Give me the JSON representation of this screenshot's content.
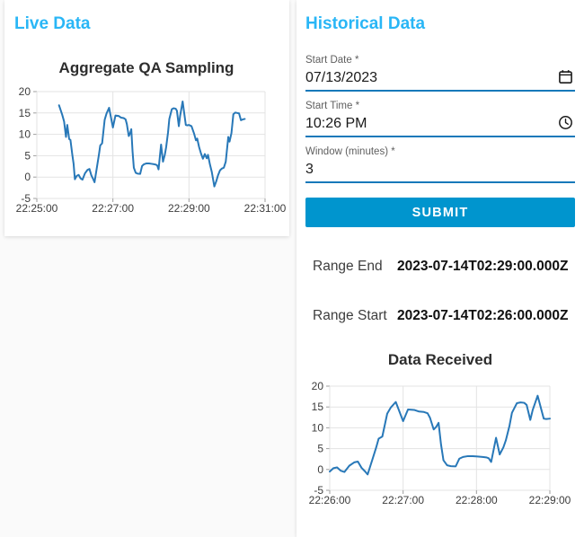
{
  "colors": {
    "accent_heading": "#29b6f6",
    "submit_button_bg": "#0095ce",
    "field_underline": "#1779ba",
    "chart_line": "#2878b8",
    "page_bg": "#fafafa"
  },
  "live": {
    "title": "Live Data"
  },
  "historical": {
    "title": "Historical Data",
    "fields": [
      {
        "label": "Start Date *",
        "value": "07/13/2023",
        "icon": "calendar"
      },
      {
        "label": "Start Time *",
        "value": "10:26 PM",
        "icon": "clock"
      },
      {
        "label": "Window (minutes) *",
        "value": "3",
        "icon": ""
      }
    ],
    "submit_label": "SUBMIT",
    "results": [
      {
        "label": "Range End",
        "value": "2023-07-14T02:29:00.000Z"
      },
      {
        "label": "Range Start",
        "value": "2023-07-14T02:26:00.000Z"
      }
    ]
  },
  "chart_data": [
    {
      "type": "line",
      "title": "Aggregate QA Sampling",
      "xlabel": "",
      "ylabel": "",
      "x_unit": "seconds since 22:25:00",
      "x_range": [
        0,
        360
      ],
      "y_range": [
        -5,
        20
      ],
      "grid": true,
      "legend": "none",
      "line_color": "#2878b8",
      "x_ticks": [
        {
          "t": 0,
          "label": "22:25:00"
        },
        {
          "t": 120,
          "label": "22:27:00"
        },
        {
          "t": 240,
          "label": "22:29:00"
        },
        {
          "t": 360,
          "label": "22:31:00"
        }
      ],
      "y_ticks": [
        -5,
        0,
        5,
        10,
        15,
        20
      ],
      "points": [
        [
          35,
          16.8
        ],
        [
          40,
          14.6
        ],
        [
          43,
          13.0
        ],
        [
          46,
          9.4
        ],
        [
          48,
          12.2
        ],
        [
          51,
          8.9
        ],
        [
          53,
          8.7
        ],
        [
          56,
          5.2
        ],
        [
          58,
          3.1
        ],
        [
          60,
          -0.5
        ],
        [
          63,
          0.3
        ],
        [
          66,
          0.5
        ],
        [
          69,
          -0.3
        ],
        [
          72,
          -0.6
        ],
        [
          76,
          0.9
        ],
        [
          80,
          1.7
        ],
        [
          83,
          1.9
        ],
        [
          86,
          0.4
        ],
        [
          89,
          -0.5
        ],
        [
          91,
          -1.2
        ],
        [
          95,
          2.5
        ],
        [
          98,
          5.3
        ],
        [
          100,
          7.4
        ],
        [
          103,
          7.9
        ],
        [
          107,
          13.4
        ],
        [
          110,
          14.9
        ],
        [
          114,
          16.2
        ],
        [
          120,
          11.6
        ],
        [
          124,
          14.4
        ],
        [
          129,
          14.3
        ],
        [
          133,
          13.9
        ],
        [
          137,
          13.8
        ],
        [
          140,
          13.5
        ],
        [
          142,
          12.4
        ],
        [
          145,
          9.6
        ],
        [
          147,
          10.2
        ],
        [
          149,
          11.2
        ],
        [
          151,
          6.0
        ],
        [
          153,
          2.2
        ],
        [
          156,
          1.0
        ],
        [
          159,
          0.8
        ],
        [
          163,
          0.75
        ],
        [
          166,
          2.6
        ],
        [
          169,
          3.0
        ],
        [
          173,
          3.2
        ],
        [
          177,
          3.2
        ],
        [
          181,
          3.1
        ],
        [
          185,
          3.0
        ],
        [
          188,
          2.9
        ],
        [
          190,
          2.7
        ],
        [
          192,
          1.8
        ],
        [
          196,
          7.6
        ],
        [
          199,
          3.6
        ],
        [
          202,
          5.3
        ],
        [
          204,
          7.0
        ],
        [
          207,
          10.5
        ],
        [
          209,
          13.6
        ],
        [
          213,
          15.9
        ],
        [
          216,
          16.1
        ],
        [
          219,
          16.0
        ],
        [
          221,
          15.5
        ],
        [
          224,
          11.9
        ],
        [
          226,
          14.3
        ],
        [
          230,
          17.7
        ],
        [
          235,
          12.2
        ],
        [
          237,
          12.1
        ],
        [
          240,
          12.2
        ],
        [
          244,
          11.9
        ],
        [
          248,
          10.2
        ],
        [
          251,
          8.6
        ],
        [
          253,
          9.0
        ],
        [
          256,
          7.0
        ],
        [
          259,
          5.5
        ],
        [
          262,
          4.3
        ],
        [
          265,
          5.4
        ],
        [
          268,
          4.4
        ],
        [
          270,
          5.2
        ],
        [
          273,
          3.0
        ],
        [
          276,
          1.2
        ],
        [
          280,
          -2.2
        ],
        [
          283,
          -1.0
        ],
        [
          286,
          0.5
        ],
        [
          289,
          1.6
        ],
        [
          292,
          2.0
        ],
        [
          295,
          2.2
        ],
        [
          298,
          3.6
        ],
        [
          302,
          9.4
        ],
        [
          304,
          8.3
        ],
        [
          307,
          10.3
        ],
        [
          310,
          14.7
        ],
        [
          313,
          15.1
        ],
        [
          316,
          15.0
        ],
        [
          319,
          14.9
        ],
        [
          322,
          13.3
        ],
        [
          325,
          13.5
        ],
        [
          328,
          13.6
        ]
      ]
    },
    {
      "type": "line",
      "title": "Data Received",
      "xlabel": "",
      "ylabel": "",
      "x_unit": "seconds since 22:25:00",
      "x_range": [
        60,
        240
      ],
      "y_range": [
        -5,
        20
      ],
      "grid": true,
      "legend": "none",
      "line_color": "#2878b8",
      "x_ticks": [
        {
          "t": 60,
          "label": "22:26:00"
        },
        {
          "t": 120,
          "label": "22:27:00"
        },
        {
          "t": 180,
          "label": "22:28:00"
        },
        {
          "t": 240,
          "label": "22:29:00"
        }
      ],
      "y_ticks": [
        -5,
        0,
        5,
        10,
        15,
        20
      ],
      "points": [
        [
          60,
          -0.5
        ],
        [
          63,
          0.3
        ],
        [
          66,
          0.5
        ],
        [
          69,
          -0.3
        ],
        [
          72,
          -0.6
        ],
        [
          76,
          0.9
        ],
        [
          80,
          1.7
        ],
        [
          83,
          1.9
        ],
        [
          86,
          0.4
        ],
        [
          89,
          -0.5
        ],
        [
          91,
          -1.2
        ],
        [
          95,
          2.5
        ],
        [
          98,
          5.3
        ],
        [
          100,
          7.4
        ],
        [
          103,
          7.9
        ],
        [
          107,
          13.4
        ],
        [
          110,
          14.9
        ],
        [
          114,
          16.2
        ],
        [
          120,
          11.6
        ],
        [
          124,
          14.4
        ],
        [
          129,
          14.3
        ],
        [
          133,
          13.9
        ],
        [
          137,
          13.8
        ],
        [
          140,
          13.5
        ],
        [
          142,
          12.4
        ],
        [
          145,
          9.6
        ],
        [
          147,
          10.2
        ],
        [
          149,
          11.2
        ],
        [
          151,
          6.0
        ],
        [
          153,
          2.2
        ],
        [
          156,
          1.0
        ],
        [
          159,
          0.8
        ],
        [
          163,
          0.75
        ],
        [
          166,
          2.6
        ],
        [
          169,
          3.0
        ],
        [
          173,
          3.2
        ],
        [
          177,
          3.2
        ],
        [
          181,
          3.1
        ],
        [
          185,
          3.0
        ],
        [
          188,
          2.9
        ],
        [
          190,
          2.7
        ],
        [
          192,
          1.8
        ],
        [
          196,
          7.6
        ],
        [
          199,
          3.6
        ],
        [
          202,
          5.3
        ],
        [
          204,
          7.0
        ],
        [
          207,
          10.5
        ],
        [
          209,
          13.6
        ],
        [
          213,
          15.9
        ],
        [
          216,
          16.1
        ],
        [
          219,
          16.0
        ],
        [
          221,
          15.5
        ],
        [
          224,
          11.9
        ],
        [
          226,
          14.3
        ],
        [
          230,
          17.7
        ],
        [
          235,
          12.2
        ],
        [
          237,
          12.1
        ],
        [
          240,
          12.2
        ]
      ]
    }
  ]
}
